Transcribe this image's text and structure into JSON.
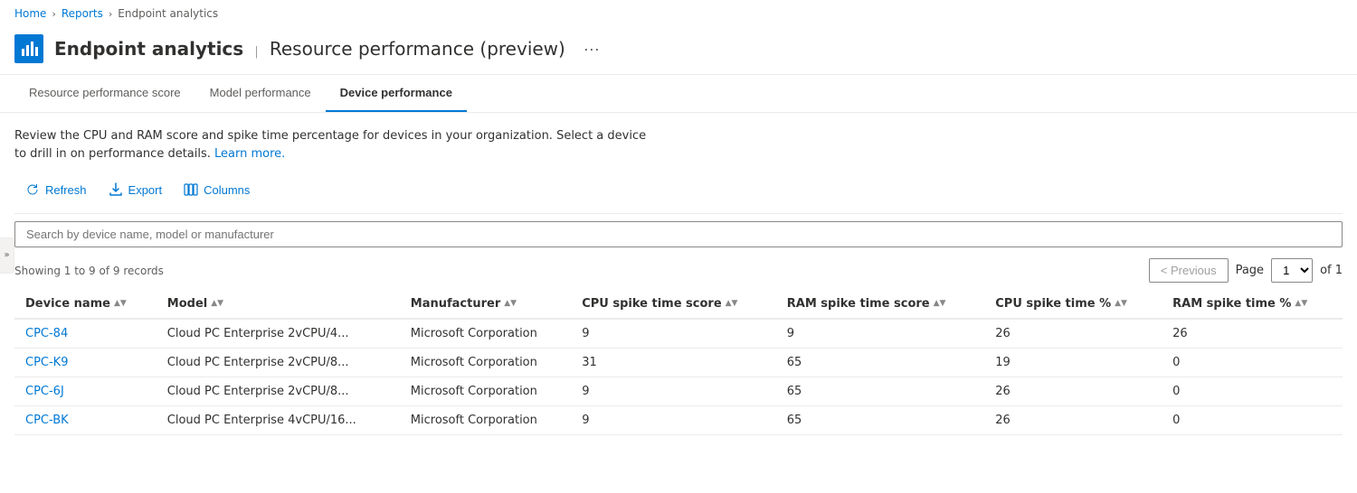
{
  "breadcrumb": {
    "items": [
      {
        "label": "Home",
        "href": "#"
      },
      {
        "label": "Reports",
        "href": "#"
      },
      {
        "label": "Endpoint analytics",
        "href": "#",
        "active": true
      }
    ],
    "separators": [
      ">",
      ">"
    ]
  },
  "header": {
    "title": "Endpoint analytics",
    "separator": "|",
    "subtitle": "Resource performance (preview)",
    "more_label": "···"
  },
  "tabs": [
    {
      "label": "Resource performance score",
      "active": false
    },
    {
      "label": "Model performance",
      "active": false
    },
    {
      "label": "Device performance",
      "active": true
    }
  ],
  "description": {
    "text": "Review the CPU and RAM score and spike time percentage for devices in your organization. Select a device to drill in on performance details.",
    "link_text": "Learn more.",
    "link_href": "#"
  },
  "toolbar": {
    "refresh_label": "Refresh",
    "export_label": "Export",
    "columns_label": "Columns"
  },
  "search": {
    "placeholder": "Search by device name, model or manufacturer"
  },
  "pagination": {
    "records_info": "Showing 1 to 9 of 9 records",
    "previous_label": "< Previous",
    "page_label": "Page",
    "current_page": "1",
    "of_label": "of 1"
  },
  "table": {
    "columns": [
      {
        "label": "Device name",
        "key": "device_name"
      },
      {
        "label": "Model",
        "key": "model"
      },
      {
        "label": "Manufacturer",
        "key": "manufacturer"
      },
      {
        "label": "CPU spike time score",
        "key": "cpu_spike_score"
      },
      {
        "label": "RAM spike time score",
        "key": "ram_spike_score"
      },
      {
        "label": "CPU spike time %",
        "key": "cpu_spike_pct"
      },
      {
        "label": "RAM spike time %",
        "key": "ram_spike_pct"
      }
    ],
    "rows": [
      {
        "device_name": "CPC-84",
        "model": "Cloud PC Enterprise 2vCPU/4...",
        "manufacturer": "Microsoft Corporation",
        "cpu_spike_score": "9",
        "ram_spike_score": "9",
        "cpu_spike_pct": "26",
        "ram_spike_pct": "26"
      },
      {
        "device_name": "CPC-K9",
        "model": "Cloud PC Enterprise 2vCPU/8...",
        "manufacturer": "Microsoft Corporation",
        "cpu_spike_score": "31",
        "ram_spike_score": "65",
        "cpu_spike_pct": "19",
        "ram_spike_pct": "0"
      },
      {
        "device_name": "CPC-6J",
        "model": "Cloud PC Enterprise 2vCPU/8...",
        "manufacturer": "Microsoft Corporation",
        "cpu_spike_score": "9",
        "ram_spike_score": "65",
        "cpu_spike_pct": "26",
        "ram_spike_pct": "0"
      },
      {
        "device_name": "CPC-BK",
        "model": "Cloud PC Enterprise 4vCPU/16...",
        "manufacturer": "Microsoft Corporation",
        "cpu_spike_score": "9",
        "ram_spike_score": "65",
        "cpu_spike_pct": "26",
        "ram_spike_pct": "0"
      }
    ]
  }
}
